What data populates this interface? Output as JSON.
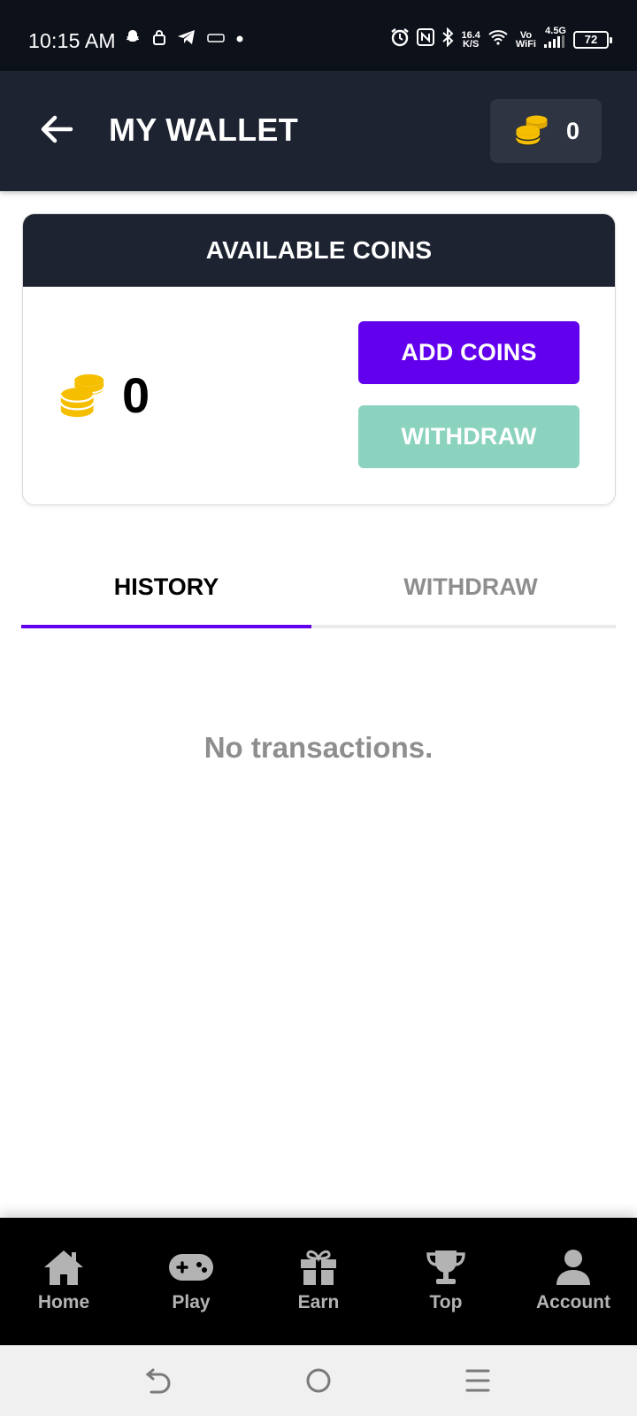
{
  "status_bar": {
    "time": "10:15 AM",
    "net_speed_value": "16.4",
    "net_speed_unit": "K/S",
    "vowifi_top": "Vo",
    "vowifi_bottom": "WiFi",
    "network_type": "4.5G",
    "battery": "72",
    "icons": [
      "snapchat-icon",
      "lock-icon",
      "telegram-icon",
      "app-icon",
      "dot-icon",
      "alarm-icon",
      "nfc-icon",
      "bluetooth-icon",
      "wifi-icon",
      "signal-icon",
      "battery-icon"
    ]
  },
  "header": {
    "title": "MY WALLET",
    "coin_balance": "0",
    "back_icon": "arrow-left-icon",
    "coin_icon": "coins-icon"
  },
  "card": {
    "title": "AVAILABLE COINS",
    "balance": "0",
    "add_label": "ADD COINS",
    "withdraw_label": "WITHDRAW"
  },
  "tabs": [
    {
      "label": "HISTORY",
      "active": true
    },
    {
      "label": "WITHDRAW",
      "active": false
    }
  ],
  "empty_message": "No transactions.",
  "bottom_nav": [
    {
      "label": "Home",
      "icon": "home-icon"
    },
    {
      "label": "Play",
      "icon": "gamepad-icon"
    },
    {
      "label": "Earn",
      "icon": "gift-icon"
    },
    {
      "label": "Top",
      "icon": "trophy-icon"
    },
    {
      "label": "Account",
      "icon": "user-icon"
    }
  ],
  "colors": {
    "accent": "#6200ee",
    "header_bg": "#1e2331",
    "withdraw_btn": "#8bd3bf",
    "coin": "#f5bf00",
    "nav_bg": "#000000",
    "muted_text": "#8e8e8e"
  }
}
